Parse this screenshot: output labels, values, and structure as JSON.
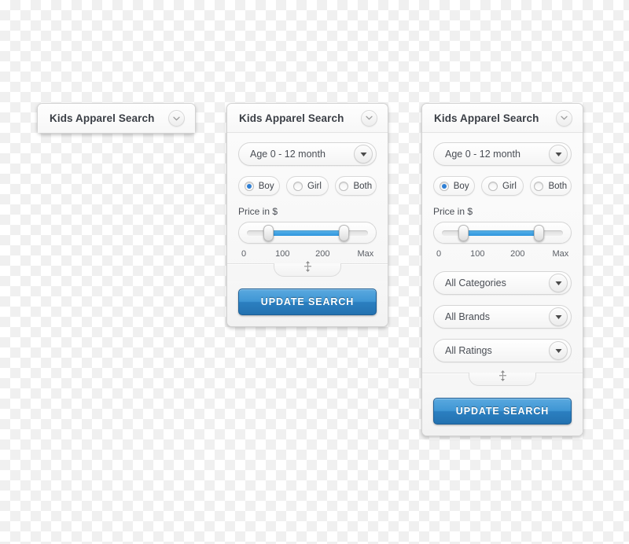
{
  "panels": [
    {
      "id": "collapsed",
      "title": "Kids Apparel Search",
      "header_icon": "chevron-down-icon",
      "collapsed": true
    },
    {
      "id": "expanded-short",
      "title": "Kids Apparel Search",
      "header_icon": "chevron-down-icon",
      "collapsed": false,
      "age_dropdown": {
        "value": "Age 0 - 12 month",
        "icon": "triangle-down-icon"
      },
      "gender": {
        "options": [
          {
            "label": "Boy",
            "selected": true
          },
          {
            "label": "Girl",
            "selected": false
          },
          {
            "label": "Both",
            "selected": false
          }
        ]
      },
      "price_slider": {
        "title": "Price in $",
        "ticks": [
          "0",
          "100",
          "200",
          "Max"
        ],
        "min_percent": 18,
        "max_percent": 80
      },
      "grip_icon": "vertical-resize-icon",
      "submit_label": "UPDATE SEARCH"
    },
    {
      "id": "expanded-full",
      "title": "Kids Apparel Search",
      "header_icon": "chevron-down-icon",
      "collapsed": false,
      "age_dropdown": {
        "value": "Age 0 - 12 month",
        "icon": "triangle-down-icon"
      },
      "gender": {
        "options": [
          {
            "label": "Boy",
            "selected": true
          },
          {
            "label": "Girl",
            "selected": false
          },
          {
            "label": "Both",
            "selected": false
          }
        ]
      },
      "price_slider": {
        "title": "Price in $",
        "ticks": [
          "0",
          "100",
          "200",
          "Max"
        ],
        "min_percent": 18,
        "max_percent": 80
      },
      "filters": [
        {
          "value": "All Categories",
          "icon": "triangle-down-icon"
        },
        {
          "value": "All Brands",
          "icon": "triangle-down-icon"
        },
        {
          "value": "All Ratings",
          "icon": "triangle-down-icon"
        }
      ],
      "grip_icon": "vertical-resize-icon",
      "submit_label": "UPDATE SEARCH"
    }
  ],
  "colors": {
    "accent_blue": "#2e95dd",
    "button_blue_top": "#5aa9df",
    "button_blue_bottom": "#2472b0",
    "radio_selected": "#2e7fd4",
    "panel_bg": "#fdfdfd",
    "title_text": "#3b3f46"
  }
}
